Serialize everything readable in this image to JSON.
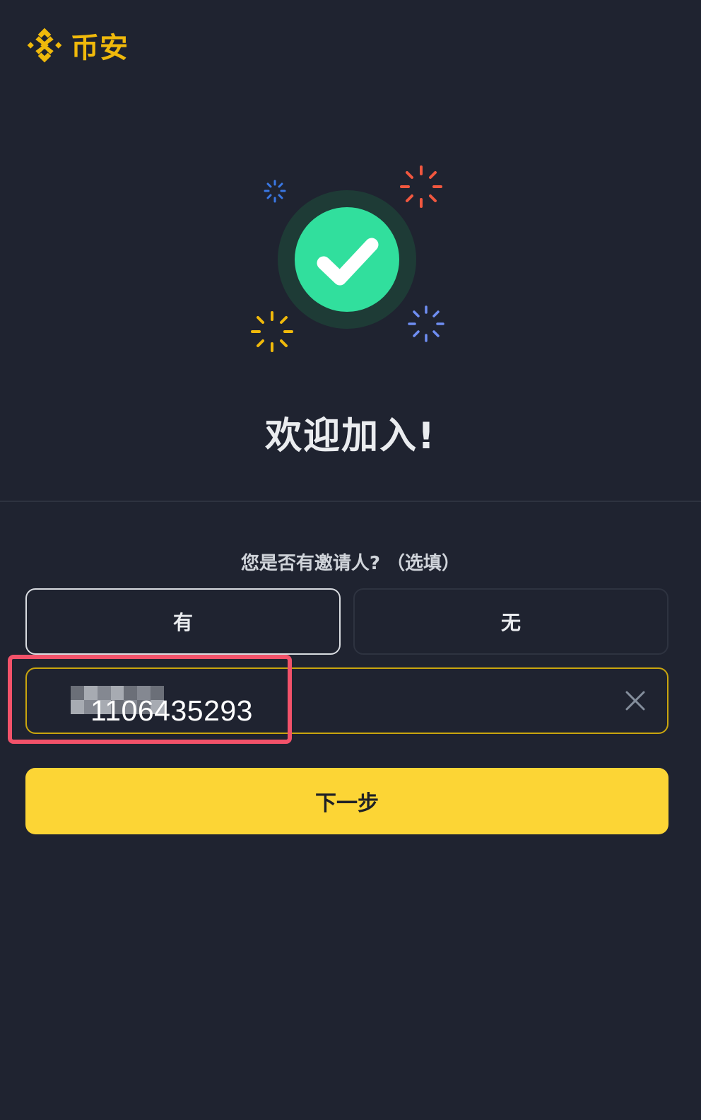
{
  "brand": {
    "name": "币安",
    "logo_icon": "binance-logo-icon",
    "color": "#f0b90b"
  },
  "hero": {
    "icon": "success-check-icon",
    "accent": "#31df9d",
    "sparkle_colors": [
      "#3a77e3",
      "#f1573f",
      "#f0b90b",
      "#6f8ef2"
    ]
  },
  "welcome_title": "欢迎加入!",
  "referral": {
    "question": "您是否有邀请人? （选填）",
    "options": [
      {
        "label": "有",
        "selected": true
      },
      {
        "label": "无",
        "selected": false
      }
    ],
    "input_value": "1106435293",
    "clear_icon": "close-icon"
  },
  "next_button": {
    "label": "下一步",
    "color": "#fcd535"
  },
  "annotation": {
    "color": "#f2526a"
  }
}
